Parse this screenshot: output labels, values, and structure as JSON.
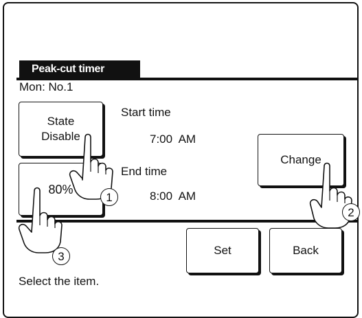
{
  "header": {
    "title": "Peak-cut timer"
  },
  "schedule": {
    "day_label": "Mon: No.1"
  },
  "buttons": {
    "state_line1": "State",
    "state_line2": "Disable",
    "percent": "80%",
    "change": "Change",
    "set": "Set",
    "back": "Back"
  },
  "times": {
    "start_label": "Start time",
    "start_value": "7:00  AM",
    "end_label": "End time",
    "end_value": "8:00  AM"
  },
  "footer": {
    "prompt": "Select the item."
  },
  "callouts": {
    "step1": "1",
    "step2": "2",
    "step3": "3"
  },
  "icons": {
    "pointer": "pointing-hand-icon"
  }
}
